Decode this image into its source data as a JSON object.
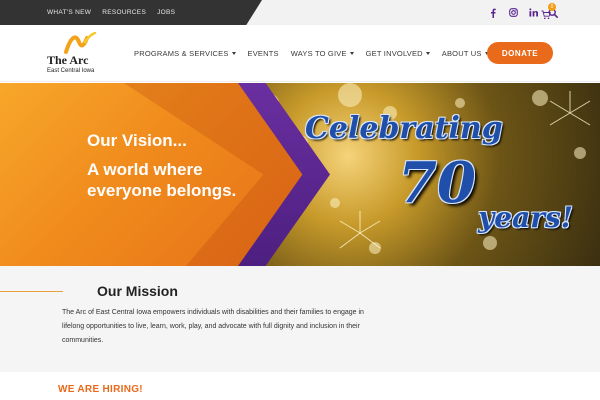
{
  "utility_bar": {
    "links": [
      "WHAT'S NEW",
      "RESOURCES",
      "JOBS"
    ],
    "social_icons": [
      "facebook-icon",
      "instagram-icon",
      "linkedin-icon",
      "search-icon"
    ],
    "cart_count": "0"
  },
  "logo": {
    "name": "The Arc",
    "subtitle": "East Central Iowa"
  },
  "nav": {
    "items": [
      {
        "label": "PROGRAMS & SERVICES",
        "dropdown": true
      },
      {
        "label": "EVENTS",
        "dropdown": false
      },
      {
        "label": "WAYS TO GIVE",
        "dropdown": true
      },
      {
        "label": "GET INVOLVED",
        "dropdown": true
      },
      {
        "label": "ABOUT US",
        "dropdown": true
      }
    ],
    "donate_label": "DONATE"
  },
  "hero": {
    "vision_title": "Our Vision...",
    "vision_text": "A world where everyone belongs.",
    "celebrate_line1": "Celebrating",
    "celebrate_number": "70",
    "celebrate_line2": "years!"
  },
  "mission": {
    "title": "Our Mission",
    "text": "The Arc of East Central Iowa empowers individuals with disabilities and their families to engage in lifelong opportunities to live, learn, work, play, and advocate with full dignity and inclusion in their communities."
  },
  "hiring": {
    "title": "WE ARE HIRING!"
  },
  "colors": {
    "accent_orange": "#e96a1b",
    "purple": "#5b2590",
    "dark_bar": "#333333",
    "celebration_blue": "#1f4fa8"
  }
}
